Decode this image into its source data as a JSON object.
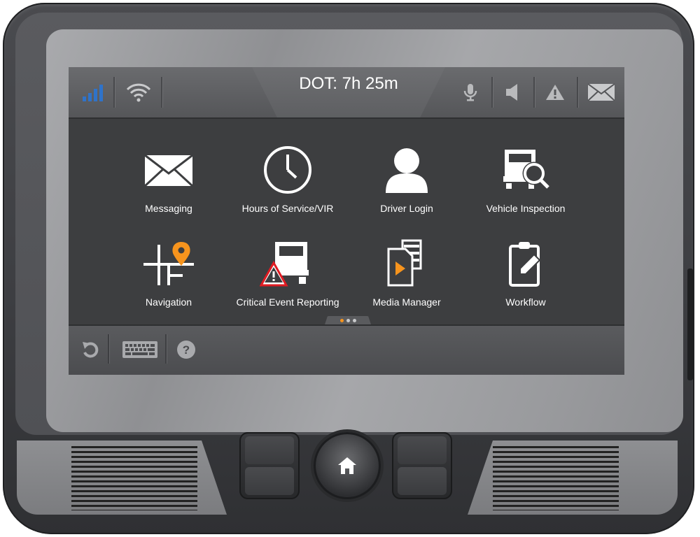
{
  "status_bar": {
    "dot_text": "DOT: 7h 25m",
    "left_icons": [
      "signal-icon",
      "wifi-icon"
    ],
    "right_icons": [
      "microphone-icon",
      "speaker-icon",
      "warning-icon",
      "mail-icon"
    ]
  },
  "apps": [
    {
      "label": "Messaging",
      "icon": "envelope-icon"
    },
    {
      "label": "Hours of Service/VIR",
      "icon": "clock-icon"
    },
    {
      "label": "Driver Login",
      "icon": "user-icon"
    },
    {
      "label": "Vehicle Inspection",
      "icon": "truck-magnifier-icon"
    },
    {
      "label": "Navigation",
      "icon": "map-pin-icon"
    },
    {
      "label": "Critical Event Reporting",
      "icon": "truck-alert-icon"
    },
    {
      "label": "Media Manager",
      "icon": "media-play-icon"
    },
    {
      "label": "Workflow",
      "icon": "clipboard-pen-icon"
    }
  ],
  "pager": {
    "pages": 3,
    "active": 1
  },
  "bottom_bar": {
    "icons": [
      "back-icon",
      "keyboard-icon",
      "help-icon"
    ]
  },
  "colors": {
    "signal": "#2f73c9",
    "accent_orange": "#f7941d",
    "alert_red": "#e01b22",
    "icon_white": "#ffffff",
    "icon_gray": "#b9babc"
  }
}
